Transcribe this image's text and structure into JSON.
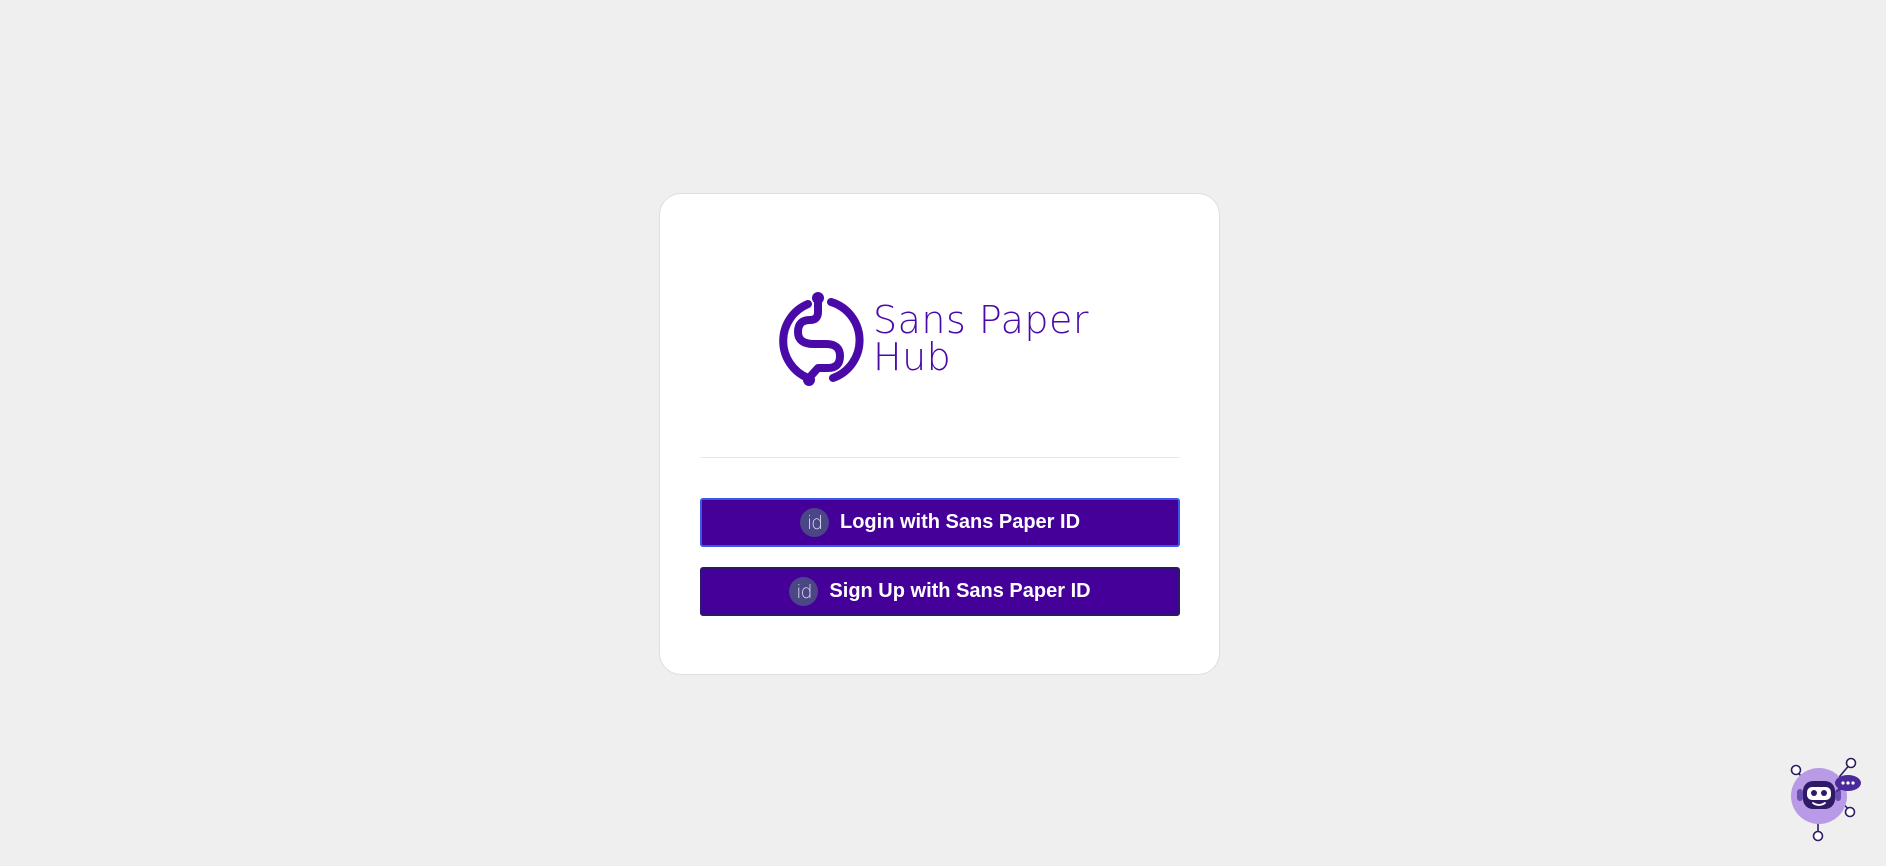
{
  "app": {
    "logo_line1": "Sans Paper",
    "logo_line2": "Hub"
  },
  "actions": {
    "login_label": "Login with Sans Paper ID",
    "signup_label": "Sign Up with Sans Paper ID",
    "id_icon_text": "id"
  },
  "icons": {
    "brand": "brand-s-logo-icon",
    "id": "id-icon",
    "assistant": "chat-assistant-robot-icon"
  },
  "colors": {
    "brand": "#440099",
    "background": "#efefef",
    "card": "#ffffff",
    "assistant_bubble": "#b99ae6"
  }
}
